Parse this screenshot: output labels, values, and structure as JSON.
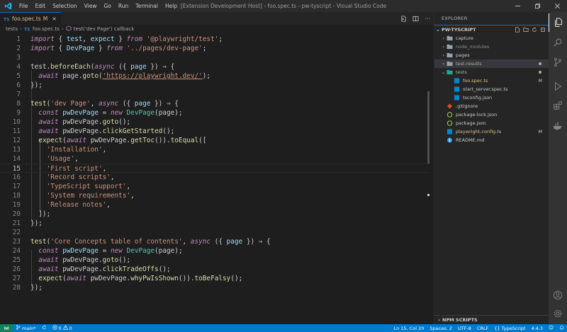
{
  "titlebar": {
    "menu": [
      "File",
      "Edit",
      "Selection",
      "View",
      "Go",
      "Run",
      "Terminal",
      "Help"
    ],
    "window_title": "[Extension Development Host] - foo.spec.ts - pw-tyscript - Visual Studio Code",
    "controls": [
      "minimize",
      "restore",
      "close"
    ]
  },
  "editor": {
    "tab": {
      "label": "foo.spec.ts",
      "badge": "M",
      "icon": "TS"
    },
    "breadcrumb": [
      "tests",
      "foo.spec.ts",
      "test('dev Page') callback"
    ],
    "current_line": 15,
    "lines": [
      [
        [
          "kw",
          "import"
        ],
        [
          "op",
          " { "
        ],
        [
          "id",
          "test"
        ],
        [
          "op",
          ", "
        ],
        [
          "id",
          "expect"
        ],
        [
          "op",
          " } "
        ],
        [
          "kw",
          "from"
        ],
        [
          "op",
          " "
        ],
        [
          "str",
          "'@playwright/test'"
        ],
        [
          "op",
          ";"
        ]
      ],
      [
        [
          "kw",
          "import"
        ],
        [
          "op",
          " { "
        ],
        [
          "id",
          "DevPage"
        ],
        [
          "op",
          " } "
        ],
        [
          "kw",
          "from"
        ],
        [
          "op",
          " "
        ],
        [
          "str",
          "'../pages/dev-page'"
        ],
        [
          "op",
          ";"
        ]
      ],
      [],
      [
        [
          "var",
          "test"
        ],
        [
          "op",
          "."
        ],
        [
          "fn",
          "beforeEach"
        ],
        [
          "op",
          "("
        ],
        [
          "kw",
          "async"
        ],
        [
          "op",
          " ({ "
        ],
        [
          "id",
          "page"
        ],
        [
          "op",
          " }) ⇒ {"
        ]
      ],
      [
        [
          "op",
          "  "
        ],
        [
          "kw",
          "await"
        ],
        [
          "op",
          " "
        ],
        [
          "var",
          "page"
        ],
        [
          "op",
          "."
        ],
        [
          "fn",
          "goto"
        ],
        [
          "op",
          "("
        ],
        [
          "link",
          "'https://playwright.dev/'"
        ],
        [
          "op",
          ");"
        ]
      ],
      [
        [
          "op",
          "});"
        ]
      ],
      [],
      [
        [
          "fn",
          "test"
        ],
        [
          "op",
          "("
        ],
        [
          "str",
          "'dev Page'"
        ],
        [
          "op",
          ", "
        ],
        [
          "kw",
          "async"
        ],
        [
          "op",
          " ({ "
        ],
        [
          "id",
          "page"
        ],
        [
          "op",
          " }) ⇒ {"
        ]
      ],
      [
        [
          "op",
          "  "
        ],
        [
          "kw",
          "const"
        ],
        [
          "op",
          " "
        ],
        [
          "id",
          "pwDevPage"
        ],
        [
          "op",
          " = "
        ],
        [
          "kw",
          "new"
        ],
        [
          "op",
          " "
        ],
        [
          "cls",
          "DevPage"
        ],
        [
          "op",
          "("
        ],
        [
          "var",
          "page"
        ],
        [
          "op",
          ");"
        ]
      ],
      [
        [
          "op",
          "  "
        ],
        [
          "kw",
          "await"
        ],
        [
          "op",
          " "
        ],
        [
          "var",
          "pwDevPage"
        ],
        [
          "op",
          "."
        ],
        [
          "fn",
          "goto"
        ],
        [
          "op",
          "();"
        ]
      ],
      [
        [
          "op",
          "  "
        ],
        [
          "kw",
          "await"
        ],
        [
          "op",
          " "
        ],
        [
          "var",
          "pwDevPage"
        ],
        [
          "op",
          "."
        ],
        [
          "fn",
          "clickGetStarted"
        ],
        [
          "op",
          "();"
        ]
      ],
      [
        [
          "op",
          "  "
        ],
        [
          "fn",
          "expect"
        ],
        [
          "op",
          "("
        ],
        [
          "kw",
          "await"
        ],
        [
          "op",
          " "
        ],
        [
          "var",
          "pwDevPage"
        ],
        [
          "op",
          "."
        ],
        [
          "fn",
          "getToc"
        ],
        [
          "op",
          "())."
        ],
        [
          "fn",
          "toEqual"
        ],
        [
          "op",
          "(["
        ]
      ],
      [
        [
          "op",
          "    "
        ],
        [
          "str",
          "'Installation'"
        ],
        [
          "op",
          ","
        ]
      ],
      [
        [
          "op",
          "    "
        ],
        [
          "str",
          "'Usage'"
        ],
        [
          "op",
          ","
        ]
      ],
      [
        [
          "op",
          "    "
        ],
        [
          "str",
          "'First script'"
        ],
        [
          "op",
          ","
        ]
      ],
      [
        [
          "op",
          "    "
        ],
        [
          "str",
          "'Record scripts'"
        ],
        [
          "op",
          ","
        ]
      ],
      [
        [
          "op",
          "    "
        ],
        [
          "str",
          "'TypeScript support'"
        ],
        [
          "op",
          ","
        ]
      ],
      [
        [
          "op",
          "    "
        ],
        [
          "str",
          "'System requirements'"
        ],
        [
          "op",
          ","
        ]
      ],
      [
        [
          "op",
          "    "
        ],
        [
          "str",
          "'Release notes'"
        ],
        [
          "op",
          ","
        ]
      ],
      [
        [
          "op",
          "  ]);"
        ]
      ],
      [
        [
          "op",
          "});"
        ]
      ],
      [],
      [
        [
          "fn",
          "test"
        ],
        [
          "op",
          "("
        ],
        [
          "str",
          "'Core Concepts table of contents'"
        ],
        [
          "op",
          ", "
        ],
        [
          "kw",
          "async"
        ],
        [
          "op",
          " ({ "
        ],
        [
          "id",
          "page"
        ],
        [
          "op",
          " }) ⇒ {"
        ]
      ],
      [
        [
          "op",
          "  "
        ],
        [
          "kw",
          "const"
        ],
        [
          "op",
          " "
        ],
        [
          "id",
          "pwDevPage"
        ],
        [
          "op",
          " = "
        ],
        [
          "kw",
          "new"
        ],
        [
          "op",
          " "
        ],
        [
          "cls",
          "DevPage"
        ],
        [
          "op",
          "("
        ],
        [
          "var",
          "page"
        ],
        [
          "op",
          ");"
        ]
      ],
      [
        [
          "op",
          "  "
        ],
        [
          "kw",
          "await"
        ],
        [
          "op",
          " "
        ],
        [
          "var",
          "pwDevPage"
        ],
        [
          "op",
          "."
        ],
        [
          "fn",
          "goto"
        ],
        [
          "op",
          "();"
        ]
      ],
      [
        [
          "op",
          "  "
        ],
        [
          "kw",
          "await"
        ],
        [
          "op",
          " "
        ],
        [
          "var",
          "pwDevPage"
        ],
        [
          "op",
          "."
        ],
        [
          "fn",
          "clickTradeOffs"
        ],
        [
          "op",
          "();"
        ]
      ],
      [
        [
          "op",
          "  "
        ],
        [
          "fn",
          "expect"
        ],
        [
          "op",
          "("
        ],
        [
          "kw",
          "await"
        ],
        [
          "op",
          " "
        ],
        [
          "var",
          "pwDevPage"
        ],
        [
          "op",
          "."
        ],
        [
          "fn",
          "whyPwIsShown"
        ],
        [
          "op",
          "())."
        ],
        [
          "fn",
          "toBeFalsy"
        ],
        [
          "op",
          "();"
        ]
      ],
      [
        [
          "op",
          "});"
        ]
      ]
    ]
  },
  "explorer": {
    "title": "EXPLORER",
    "section": "PW-TYSCRIPT",
    "items": [
      {
        "label": "capture",
        "kind": "folder",
        "depth": 0,
        "chevron": "›",
        "color": "#cccccc",
        "badge": ""
      },
      {
        "label": "node_modules",
        "kind": "folder",
        "depth": 0,
        "chevron": "›",
        "color": "#8c8c8c",
        "badge": ""
      },
      {
        "label": "pages",
        "kind": "folder",
        "depth": 0,
        "chevron": "›",
        "color": "#cccccc",
        "badge": ""
      },
      {
        "label": "test-results",
        "kind": "folder",
        "depth": 0,
        "chevron": "›",
        "color": "#a0ba8b",
        "badge": "dot",
        "selected": true
      },
      {
        "label": "tests",
        "kind": "folder-open",
        "depth": 0,
        "chevron": "⌄",
        "color": "#a0ba8b",
        "badge": "dot"
      },
      {
        "label": "foo.spec.ts",
        "kind": "ts",
        "depth": 1,
        "chevron": "",
        "color": "#e2c08d",
        "badge": "M"
      },
      {
        "label": "start_server.spec.ts",
        "kind": "ts",
        "depth": 1,
        "chevron": "",
        "color": "#cccccc",
        "badge": ""
      },
      {
        "label": "tsconfig.json",
        "kind": "json",
        "depth": 1,
        "chevron": "",
        "color": "#cccccc",
        "badge": ""
      },
      {
        "label": ".gitignore",
        "kind": "git",
        "depth": 0,
        "chevron": "",
        "color": "#cccccc",
        "badge": ""
      },
      {
        "label": "package-lock.json",
        "kind": "npm",
        "depth": 0,
        "chevron": "",
        "color": "#cccccc",
        "badge": ""
      },
      {
        "label": "package.json",
        "kind": "npm",
        "depth": 0,
        "chevron": "",
        "color": "#cccccc",
        "badge": ""
      },
      {
        "label": "playwright.config.ts",
        "kind": "ts",
        "depth": 0,
        "chevron": "",
        "color": "#e2c08d",
        "badge": "M"
      },
      {
        "label": "README.md",
        "kind": "info",
        "depth": 0,
        "chevron": "",
        "color": "#cccccc",
        "badge": ""
      }
    ],
    "npm_scripts": "NPM SCRIPTS"
  },
  "activity_bar": [
    "files-icon",
    "search-icon",
    "source-control-icon",
    "run-debug-icon",
    "extensions-icon",
    "docker-icon",
    "account-icon",
    "settings-gear-icon"
  ],
  "statusbar": {
    "branch": "main*",
    "errors": "0",
    "warnings": "0",
    "position": "Ln 15, Col 20",
    "spaces": "Spaces: 2",
    "encoding": "UTF-8",
    "eol": "CRLF",
    "language": "TypeScript",
    "version": "4.4.3"
  },
  "colors": {
    "accent": "#007acc",
    "modified": "#e2c08d",
    "untracked": "#a0ba8b"
  }
}
